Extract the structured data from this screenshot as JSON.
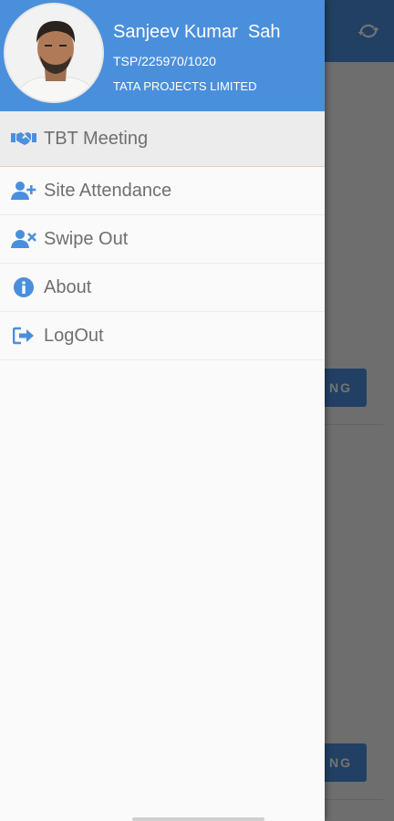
{
  "app": {
    "background_button_1": "NG",
    "background_button_2": "NG",
    "refresh_icon": "refresh-icon"
  },
  "drawer": {
    "user": {
      "name": "Sanjeev Kumar  Sah",
      "id": "TSP/225970/1020",
      "company": "TATA PROJECTS LIMITED"
    },
    "menu": [
      {
        "label": "TBT Meeting",
        "icon": "handshake-icon",
        "selected": true
      },
      {
        "label": "Site Attendance",
        "icon": "add-user-icon",
        "selected": false
      },
      {
        "label": "Swipe Out",
        "icon": "remove-user-icon",
        "selected": false
      },
      {
        "label": "About",
        "icon": "info-icon",
        "selected": false
      },
      {
        "label": "LogOut",
        "icon": "logout-icon",
        "selected": false
      }
    ]
  },
  "colors": {
    "primary": "#4a8fdc",
    "menu_text": "#6f6f6f",
    "drawer_bg": "#fafafa"
  }
}
